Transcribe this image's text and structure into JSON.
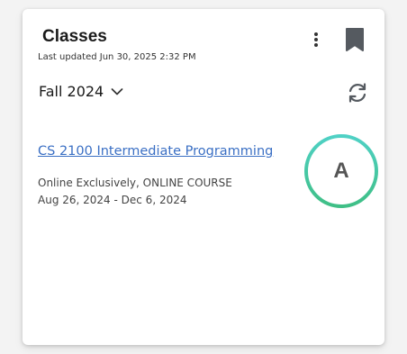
{
  "header": {
    "title": "Classes",
    "last_updated": "Last updated Jun 30, 2025 2:32 PM",
    "more_icon": "more-vertical-icon",
    "bookmark_icon": "bookmark-icon"
  },
  "term": {
    "selected": "Fall 2024",
    "dropdown_icon": "chevron-down-icon",
    "refresh_icon": "refresh-icon"
  },
  "courses": [
    {
      "name": "CS 2100 Intermediate Programming",
      "delivery": "Online Exclusively, ONLINE COURSE",
      "dates": "Aug 26, 2024 - Dec 6, 2024",
      "grade": "A"
    }
  ],
  "colors": {
    "link": "#3a6fc4",
    "grade_ring_start": "#4fd1c5",
    "grade_ring_end": "#3fbf86",
    "icon": "#555a60"
  }
}
